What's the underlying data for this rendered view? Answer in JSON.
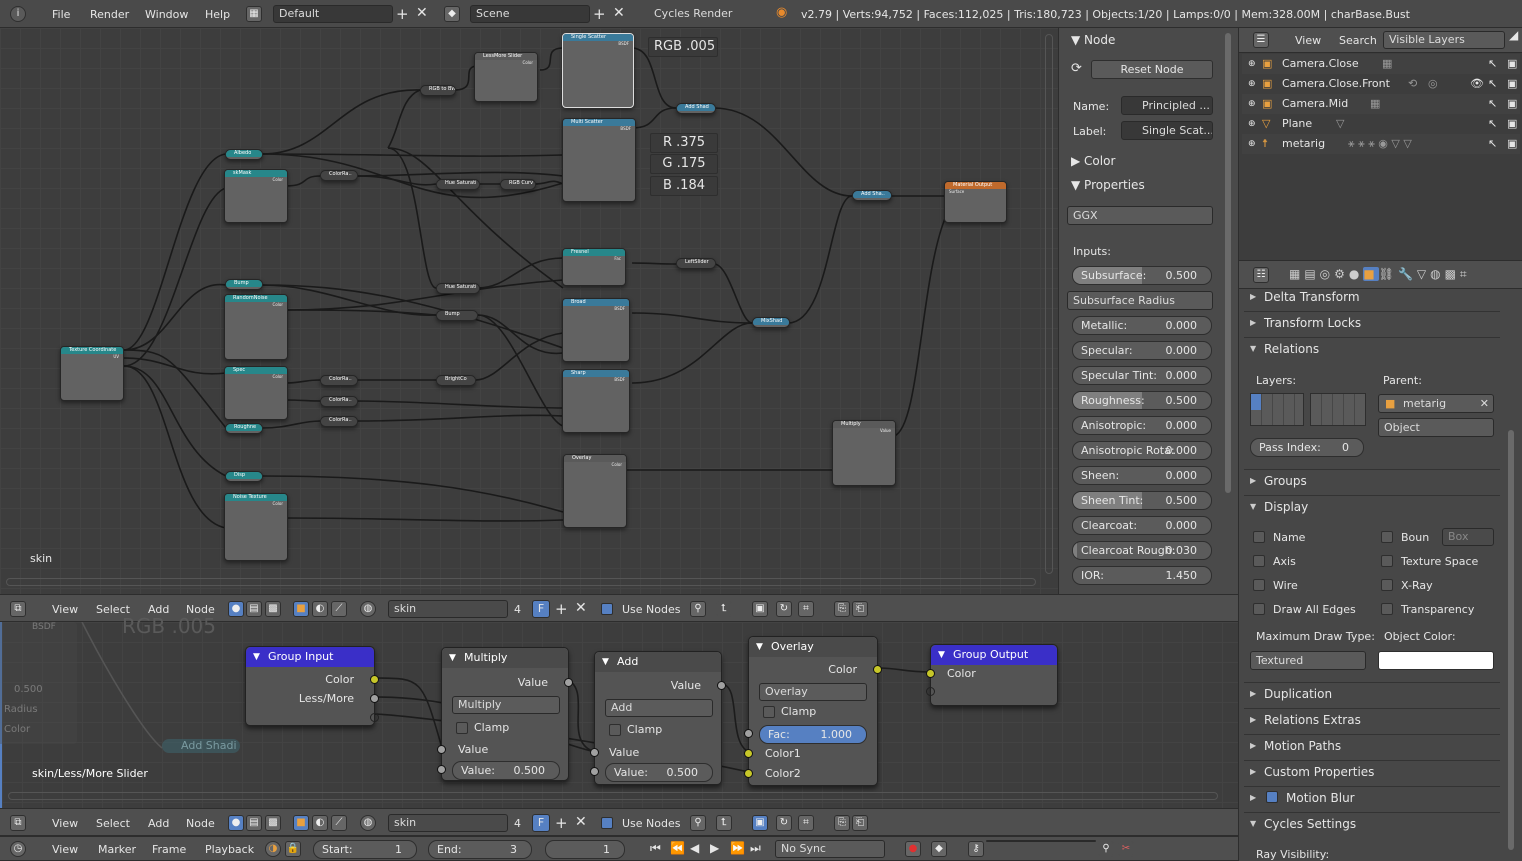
{
  "topbar": {
    "menus": [
      "File",
      "Render",
      "Window",
      "Help"
    ],
    "layout": "Default",
    "scene": "Scene",
    "engine": "Cycles Render",
    "stats": "v2.79 | Verts:94,752 | Faces:112,025 | Tris:180,723 | Objects:1/20 | Lamps:0/0 | Mem:328.00M | charBase.Bust"
  },
  "node_editor": {
    "material_label": "skin",
    "overlay_rgb": "RGB .005",
    "overlay_r": "R .375",
    "overlay_g": "G .175",
    "overlay_b": "B .184",
    "nodes": [
      {
        "title": "Single Scatter",
        "sub": "BSDF"
      },
      {
        "title": "LessMore Slider",
        "sub": "Color"
      },
      {
        "title": "Multi Scatter",
        "sub": "BSDF"
      },
      {
        "title": "Add Shad",
        "sub": ""
      },
      {
        "title": "Add Sha..",
        "sub": ""
      },
      {
        "title": "Material Output",
        "sub": "Surface"
      },
      {
        "title": "Albedo",
        "sub": ""
      },
      {
        "title": "skMask",
        "sub": "Color"
      },
      {
        "title": "ColorRa..",
        "sub": ""
      },
      {
        "title": "RGB to BW",
        "sub": ""
      },
      {
        "title": "Hue Saturati",
        "sub": ""
      },
      {
        "title": "RGB Curv",
        "sub": ""
      },
      {
        "title": "Fresnel",
        "sub": "Fac"
      },
      {
        "title": "LeftSlider",
        "sub": ""
      },
      {
        "title": "Broad",
        "sub": "BSDF"
      },
      {
        "title": "MixShad",
        "sub": ""
      },
      {
        "title": "Sharp",
        "sub": "BSDF"
      },
      {
        "title": "Bump",
        "sub": ""
      },
      {
        "title": "RandomNoise",
        "sub": "Color"
      },
      {
        "title": "Spec",
        "sub": "Color"
      },
      {
        "title": "Roughne",
        "sub": ""
      },
      {
        "title": "Texture Coordinate",
        "sub": "UV"
      },
      {
        "title": "Hue Saturati",
        "sub": ""
      },
      {
        "title": "Bump",
        "sub": ""
      },
      {
        "title": "BrightCo",
        "sub": ""
      },
      {
        "title": "ColorRa..",
        "sub": ""
      },
      {
        "title": "ColorRa..",
        "sub": ""
      },
      {
        "title": "ColorRa..",
        "sub": ""
      },
      {
        "title": "Disp",
        "sub": ""
      },
      {
        "title": "Noise Texture",
        "sub": "Color"
      },
      {
        "title": "Overlay",
        "sub": "Color"
      },
      {
        "title": "Multiply",
        "sub": "Value"
      }
    ],
    "header": {
      "menus": [
        "View",
        "Select",
        "Add",
        "Node"
      ],
      "material": "skin",
      "users": "4",
      "fake": "F",
      "use_nodes": "Use Nodes"
    }
  },
  "group_editor": {
    "path": "skin/Less/More Slider",
    "ghost_rgb": "RGB .005",
    "ghost_add": "Add Shadi",
    "ghost_val": "0.500",
    "ghost_radius": "Radius",
    "ghost_color": "Color",
    "ghost_bsdf": "BSDF",
    "group_input": {
      "title": "Group Input",
      "out1": "Color",
      "out2": "Less/More"
    },
    "multiply": {
      "title": "Multiply",
      "out": "Value",
      "op": "Multiply",
      "clamp": "Clamp",
      "in_label": "Value",
      "in_value_label": "Value:",
      "in_value": "0.500"
    },
    "add": {
      "title": "Add",
      "out": "Value",
      "op": "Add",
      "clamp": "Clamp",
      "in_label": "Value",
      "in_value_label": "Value:",
      "in_value": "0.500"
    },
    "overlay": {
      "title": "Overlay",
      "out": "Color",
      "op": "Overlay",
      "clamp": "Clamp",
      "fac_label": "Fac:",
      "fac": "1.000",
      "in1": "Color1",
      "in2": "Color2"
    },
    "group_output": {
      "title": "Group Output",
      "in": "Color"
    },
    "header": {
      "menus": [
        "View",
        "Select",
        "Add",
        "Node"
      ],
      "material": "skin",
      "users": "4",
      "fake": "F",
      "use_nodes": "Use Nodes"
    }
  },
  "timeline": {
    "menus": [
      "View",
      "Marker",
      "Frame",
      "Playback"
    ],
    "start_label": "Start:",
    "start": "1",
    "end_label": "End:",
    "end": "3",
    "current": "1",
    "sync": "No Sync"
  },
  "node_panel": {
    "section_node": "Node",
    "reset": "Reset Node",
    "name_label": "Name:",
    "name": "Principled ...",
    "label_label": "Label:",
    "label": "Single Scat...",
    "color_section": "Color",
    "properties_section": "Properties",
    "distribution": "GGX",
    "inputs_label": "Inputs:",
    "subsurface_method": "Subsurface Radius",
    "inputs": [
      {
        "label": "Subsurface:",
        "value": "0.500",
        "fill": 0.5
      },
      {
        "label": "Metallic:",
        "value": "0.000",
        "fill": 0
      },
      {
        "label": "Specular:",
        "value": "0.000",
        "fill": 0
      },
      {
        "label": "Specular Tint:",
        "value": "0.000",
        "fill": 0
      },
      {
        "label": "Roughness:",
        "value": "0.500",
        "fill": 0.5
      },
      {
        "label": "Anisotropic:",
        "value": "0.000",
        "fill": 0
      },
      {
        "label": "Anisotropic Rota:",
        "value": "0.000",
        "fill": 0
      },
      {
        "label": "Sheen:",
        "value": "0.000",
        "fill": 0
      },
      {
        "label": "Sheen Tint:",
        "value": "0.500",
        "fill": 0.5
      },
      {
        "label": "Clearcoat:",
        "value": "0.000",
        "fill": 0
      },
      {
        "label": "Clearcoat Rough:",
        "value": "0.030",
        "fill": 0.03
      },
      {
        "label": "IOR:",
        "value": "1.450",
        "fill": 0
      }
    ]
  },
  "outliner": {
    "menus": [
      "View",
      "Search"
    ],
    "filter": "Visible Layers",
    "items": [
      "Camera.Close",
      "Camera.Close.Front",
      "Camera.Mid",
      "Plane",
      "metarig"
    ]
  },
  "properties": {
    "sections_top": [
      "Delta Transform",
      "Transform Locks",
      "Relations"
    ],
    "layers_label": "Layers:",
    "parent_label": "Parent:",
    "parent": "metarig",
    "parent_type": "Object",
    "pass_index_label": "Pass Index:",
    "pass_index": "0",
    "groups": "Groups",
    "display": "Display",
    "display_checks": [
      "Name",
      "Axis",
      "Wire",
      "Draw All Edges",
      "Boun",
      "Texture Space",
      "X-Ray",
      "Transparency"
    ],
    "bounds_type": "Box",
    "max_draw_label": "Maximum Draw Type:",
    "max_draw": "Textured",
    "object_color_label": "Object Color:",
    "object_color": "#ffffff",
    "sections_bottom": [
      "Duplication",
      "Relations Extras",
      "Motion Paths",
      "Custom Properties",
      "Motion Blur",
      "Cycles Settings"
    ],
    "ray_visibility": "Ray Visibility:"
  },
  "colors": {
    "socket_yellow": "#c7c729",
    "socket_gray": "#a1a1a1",
    "socket_blue": "#6363c7",
    "group_header": "#3a2fc8",
    "accent": "#5680c2"
  }
}
